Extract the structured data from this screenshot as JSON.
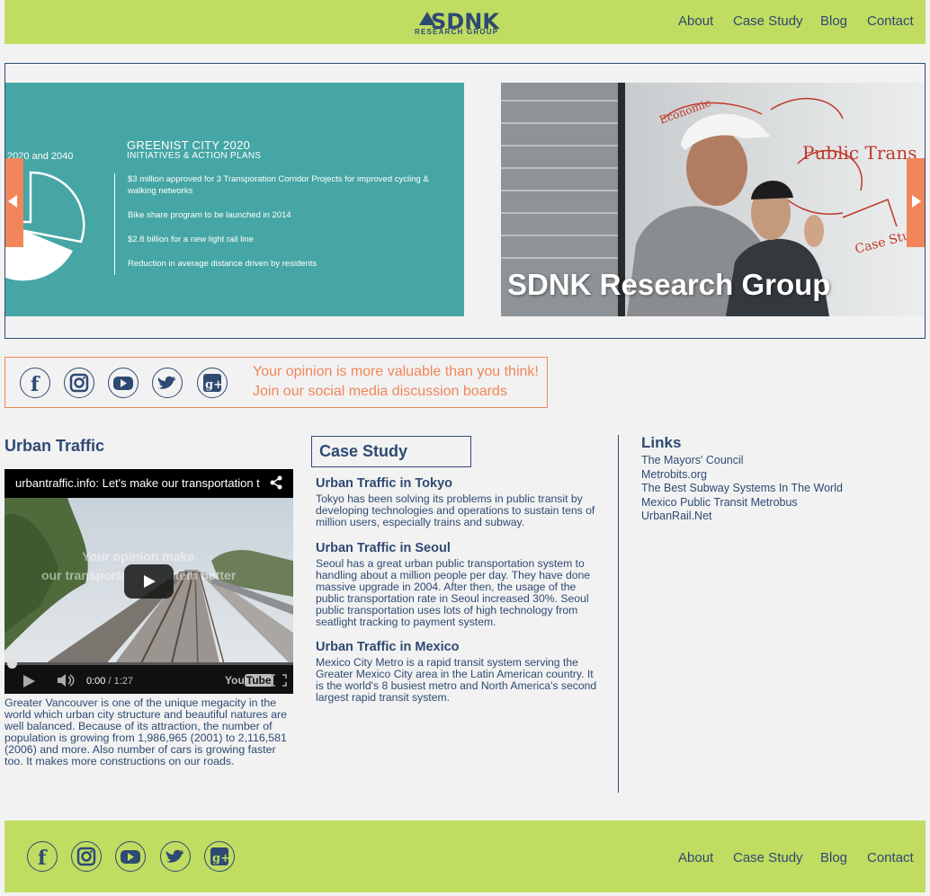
{
  "brand": {
    "logo_main": "SDNK",
    "logo_sub": "RESEARCH GROUP"
  },
  "nav": {
    "items": [
      "About",
      "Case Study",
      "Blog",
      "Contact"
    ]
  },
  "slider": {
    "slide1": {
      "years": "2020 and 2040",
      "title": "GREENIST CITY 2020",
      "subtitle": "INITIATIVES & ACTION PLANS",
      "items": [
        "$3 million approved for 3 Transporation Corridor Projects for improved cycling & walking networks",
        "Bike share program to be launched in 2014",
        "$2.8 billion for a new light rail line",
        "Reduction in average distance driven by residents"
      ]
    },
    "slide2": {
      "caption": "SDNK Research Group",
      "board_text": [
        "Public Trans",
        "Economic",
        "Transit",
        "Case Study"
      ]
    }
  },
  "social": {
    "icons": [
      "facebook-icon",
      "instagram-icon",
      "youtube-icon",
      "twitter-icon",
      "google-plus-icon"
    ],
    "text_line1": "Your opinion is more valuable than you think!",
    "text_line2": "Join our social media discussion boards"
  },
  "urban_traffic": {
    "title": "Urban Traffic",
    "video": {
      "title": "urbantraffic.info: Let's make our transportation t",
      "overlay_line1": "Your opinion make",
      "overlay_line2": "our transportation system better",
      "current_time": "0:00",
      "duration": "/ 1:27",
      "brand_you": "You",
      "brand_tube": "Tube",
      "progress": 0
    },
    "paragraph": "Greater Vancouver is one of the unique megacity in the world which urban city structure and beautiful natures are well balanced. Because of its attraction, the number of population is growing from 1,986,965 (2001) to 2,116,581 (2006) and more. Also number of cars is growing faster too. It makes more constructions on our roads."
  },
  "case_study": {
    "title": "Case Study",
    "entries": [
      {
        "heading": "Urban Traffic in Tokyo",
        "text": "Tokyo has been solving its problems in public transit by developing technologies and operations to sustain tens of million users, especially trains and subway."
      },
      {
        "heading": "Urban Traffic in Seoul",
        "text": "Seoul has a great urban public transportation system to handling about a million people per day. They have done massive upgrade in 2004. After then, the usage of the public transportation rate in Seoul increased 30%. Seoul public transportation uses lots of high technology from seatlight tracking to payment system."
      },
      {
        "heading": "Urban Traffic in Mexico",
        "text": "Mexico City Metro is a rapid transit system serving the Greater Mexico City area in the Latin American country. It is the world's 8 busiest metro and North America's second largest rapid transit system."
      }
    ]
  },
  "links": {
    "title": "Links",
    "items": [
      "The Mayors' Council",
      "Metrobits.org",
      "The Best Subway Systems In The World",
      "Mexico Public Transit Metrobus",
      "UrbanRail.Net"
    ]
  },
  "colors": {
    "header_bg": "#c0dc61",
    "navy": "#2e4a73",
    "accent_orange": "#f0865a",
    "teal": "#46a6a5",
    "page_bg": "#f2f2f2"
  }
}
